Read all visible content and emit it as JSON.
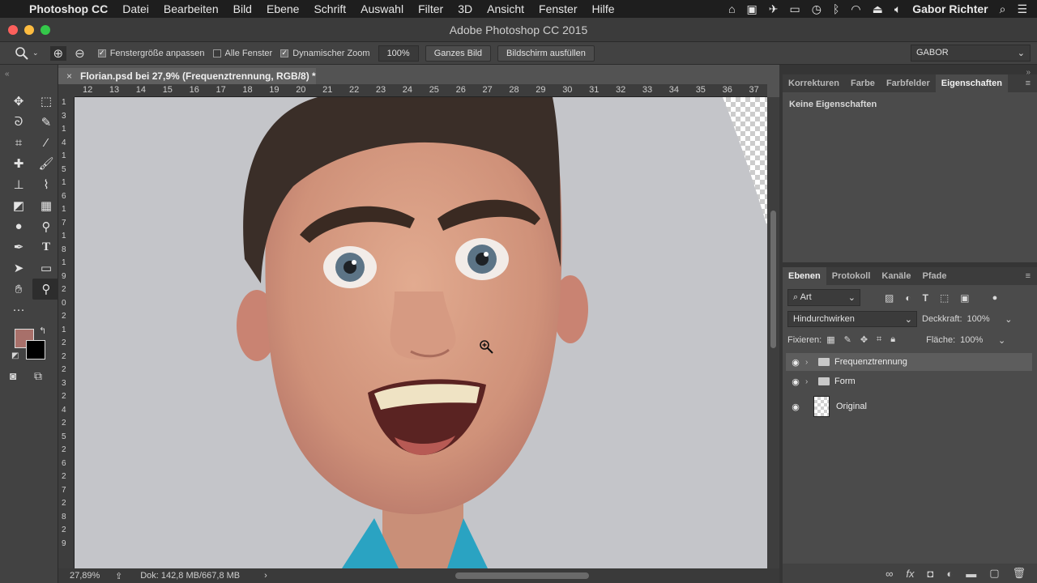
{
  "menubar": {
    "app": "Photoshop CC",
    "items": [
      "Datei",
      "Bearbeiten",
      "Bild",
      "Ebene",
      "Schrift",
      "Auswahl",
      "Filter",
      "3D",
      "Ansicht",
      "Fenster",
      "Hilfe"
    ],
    "user": "Gabor Richter"
  },
  "window": {
    "title": "Adobe Photoshop CC 2015"
  },
  "options": {
    "fit_window": "Fenstergröße anpassen",
    "all_windows": "Alle Fenster",
    "scrubby_zoom": "Dynamischer Zoom",
    "zoom_value": "100%",
    "fit_screen_button": "Ganzes Bild",
    "fill_screen_button": "Bildschirm ausfüllen",
    "workspace": "GABOR"
  },
  "document": {
    "tab_title": "Florian.psd bei 27,9% (Frequenztrennung, RGB/8) *",
    "ruler_h": [
      "12",
      "13",
      "14",
      "15",
      "16",
      "17",
      "18",
      "19",
      "20",
      "21",
      "22",
      "23",
      "24",
      "25",
      "26",
      "27",
      "28",
      "29",
      "30",
      "31",
      "32",
      "33",
      "34",
      "35",
      "36",
      "37"
    ],
    "ruler_v": [
      "1",
      "3",
      "1",
      "4",
      "1",
      "5",
      "1",
      "6",
      "1",
      "7",
      "1",
      "8",
      "1",
      "9",
      "2",
      "0",
      "2",
      "1",
      "2",
      "2",
      "2",
      "3",
      "2",
      "4",
      "2",
      "5",
      "2",
      "6",
      "2",
      "7",
      "2",
      "8",
      "2",
      "9"
    ]
  },
  "status": {
    "zoom": "27,89%",
    "doc_size": "Dok: 142,8 MB/667,8 MB"
  },
  "properties_panel": {
    "tabs": [
      "Korrekturen",
      "Farbe",
      "Farbfelder",
      "Eigenschaften"
    ],
    "active_tab": "Eigenschaften",
    "content": "Keine Eigenschaften"
  },
  "layers_panel": {
    "tabs": [
      "Ebenen",
      "Protokoll",
      "Kanäle",
      "Pfade"
    ],
    "active_tab": "Ebenen",
    "filter": "Art",
    "blend_mode": "Hindurchwirken",
    "opacity_label": "Deckkraft:",
    "opacity": "100%",
    "lock_label": "Fixieren:",
    "fill_label": "Fläche:",
    "fill": "100%",
    "layers": [
      {
        "name": "Frequenztrennung",
        "type": "group",
        "selected": true
      },
      {
        "name": "Form",
        "type": "group",
        "selected": false
      },
      {
        "name": "Original",
        "type": "smart-object",
        "selected": false
      }
    ]
  },
  "colors": {
    "foreground": "#a8706a",
    "background": "#000000"
  }
}
